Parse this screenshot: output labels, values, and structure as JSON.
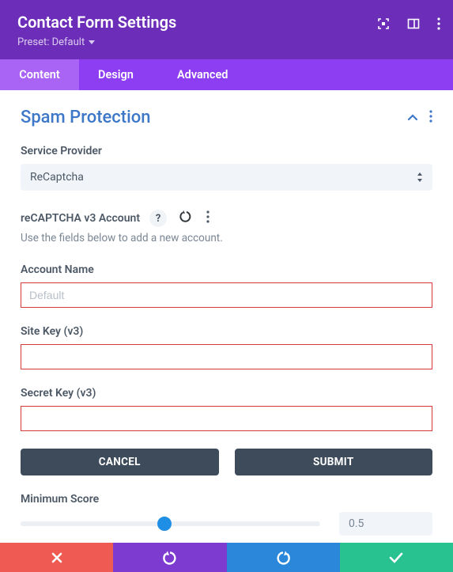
{
  "header": {
    "title": "Contact Form Settings",
    "preset_prefix": "Preset: ",
    "preset_value": "Default"
  },
  "tabs": {
    "content": "Content",
    "design": "Design",
    "advanced": "Advanced"
  },
  "section": {
    "title": "Spam Protection"
  },
  "provider": {
    "label": "Service Provider",
    "value": "ReCaptcha"
  },
  "recaptcha": {
    "label": "reCAPTCHA v3 Account",
    "helper": "Use the fields below to add a new account."
  },
  "account": {
    "label": "Account Name",
    "placeholder": "Default",
    "value": ""
  },
  "sitekey": {
    "label": "Site Key (v3)",
    "value": ""
  },
  "secretkey": {
    "label": "Secret Key (v3)",
    "value": ""
  },
  "buttons": {
    "cancel": "CANCEL",
    "submit": "SUBMIT"
  },
  "minscore": {
    "label": "Minimum Score",
    "value": "0.5"
  }
}
